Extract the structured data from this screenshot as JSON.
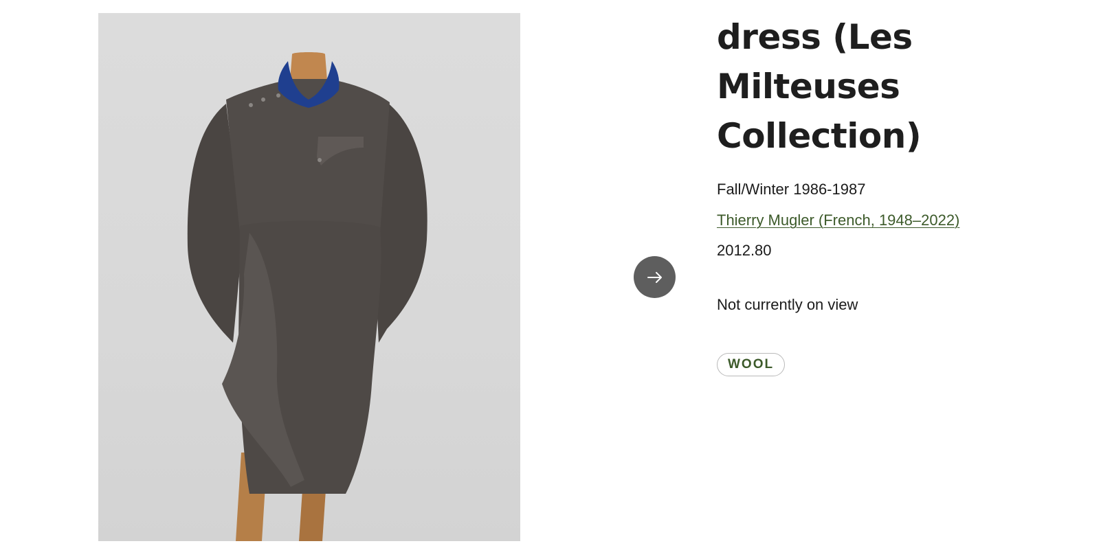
{
  "artwork": {
    "title": "dress (Les Milteuses Collection)",
    "date": "Fall/Winter 1986-1987",
    "artist": "Thierry Mugler (French, 1948–2022)",
    "accession_number": "2012.80",
    "on_view_status": "Not currently on view",
    "tags": [
      "WOOL"
    ]
  },
  "image": {
    "subject": "dark gray wool dress with blue collar on mannequin"
  },
  "navigation": {
    "next_icon": "arrow-right-icon"
  },
  "colors": {
    "link_green": "#3c5a2a",
    "button_gray": "#5e5e5e",
    "dress_gray": "#4d4845",
    "collar_blue": "#1f3f8f"
  }
}
